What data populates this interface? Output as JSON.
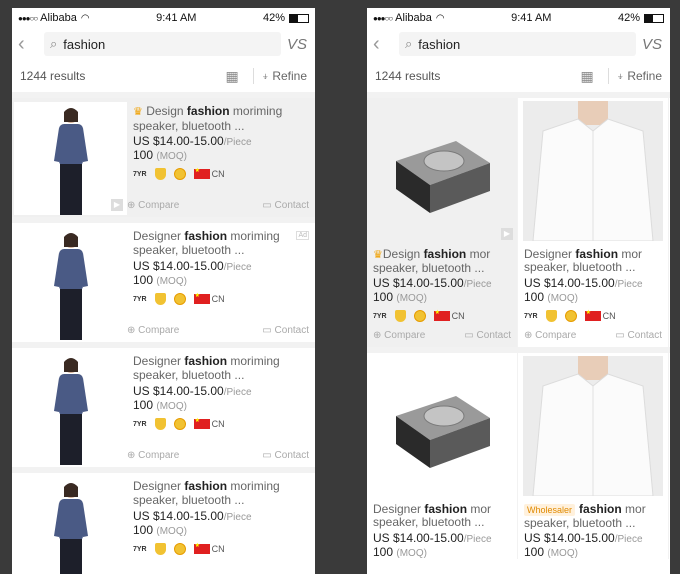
{
  "status": {
    "carrier": "Alibaba",
    "time": "9:41 AM",
    "battery": "42%"
  },
  "search": {
    "query": "fashion",
    "vs_label": "VS"
  },
  "results": {
    "count": "1244 results",
    "refine_label": "Refine"
  },
  "actions": {
    "compare": "Compare",
    "contact": "Contact"
  },
  "badges": {
    "years": "7YR",
    "country": "CN"
  },
  "ad_label": "Ad",
  "wholesaler_label": "Wholesaler",
  "list_items": [
    {
      "title_pre": "Design ",
      "title_bold": "fashion",
      "title_post": " moriming speaker, bluetooth ...",
      "price": "US $14.00-15.00",
      "unit": "/Piece",
      "moq": "100",
      "moq_unit": "(MOQ)"
    },
    {
      "title_pre": "Designer ",
      "title_bold": "fashion",
      "title_post": " moriming speaker, bluetooth ...",
      "price": "US $14.00-15.00",
      "unit": "/Piece",
      "moq": "100",
      "moq_unit": "(MOQ)"
    },
    {
      "title_pre": "Designer ",
      "title_bold": "fashion",
      "title_post": " moriming speaker, bluetooth ...",
      "price": "US $14.00-15.00",
      "unit": "/Piece",
      "moq": "100",
      "moq_unit": "(MOQ)"
    },
    {
      "title_pre": "Designer ",
      "title_bold": "fashion",
      "title_post": " moriming speaker, bluetooth ...",
      "price": "US $14.00-15.00",
      "unit": "/Piece",
      "moq": "100",
      "moq_unit": "(MOQ)"
    }
  ],
  "grid_items": [
    {
      "title_pre": "Design ",
      "title_bold": "fashion",
      "title_post": " mor speaker, bluetooth ...",
      "price": "US $14.00-15.00",
      "unit": "/Piece",
      "moq": "100",
      "moq_unit": "(MOQ)"
    },
    {
      "title_pre": "Designer ",
      "title_bold": "fashion",
      "title_post": " mor speaker, bluetooth ...",
      "price": "US $14.00-15.00",
      "unit": "/Piece",
      "moq": "100",
      "moq_unit": "(MOQ)"
    },
    {
      "title_pre": "Designer ",
      "title_bold": "fashion",
      "title_post": " mor speaker, bluetooth ...",
      "price": "US $14.00-15.00",
      "unit": "/Piece",
      "moq": "100",
      "moq_unit": "(MOQ)"
    },
    {
      "title_pre": "",
      "title_bold": "fashion",
      "title_post": " mor speaker, bluetooth ...",
      "price": "US $14.00-15.00",
      "unit": "/Piece",
      "moq": "100",
      "moq_unit": "(MOQ)"
    }
  ]
}
